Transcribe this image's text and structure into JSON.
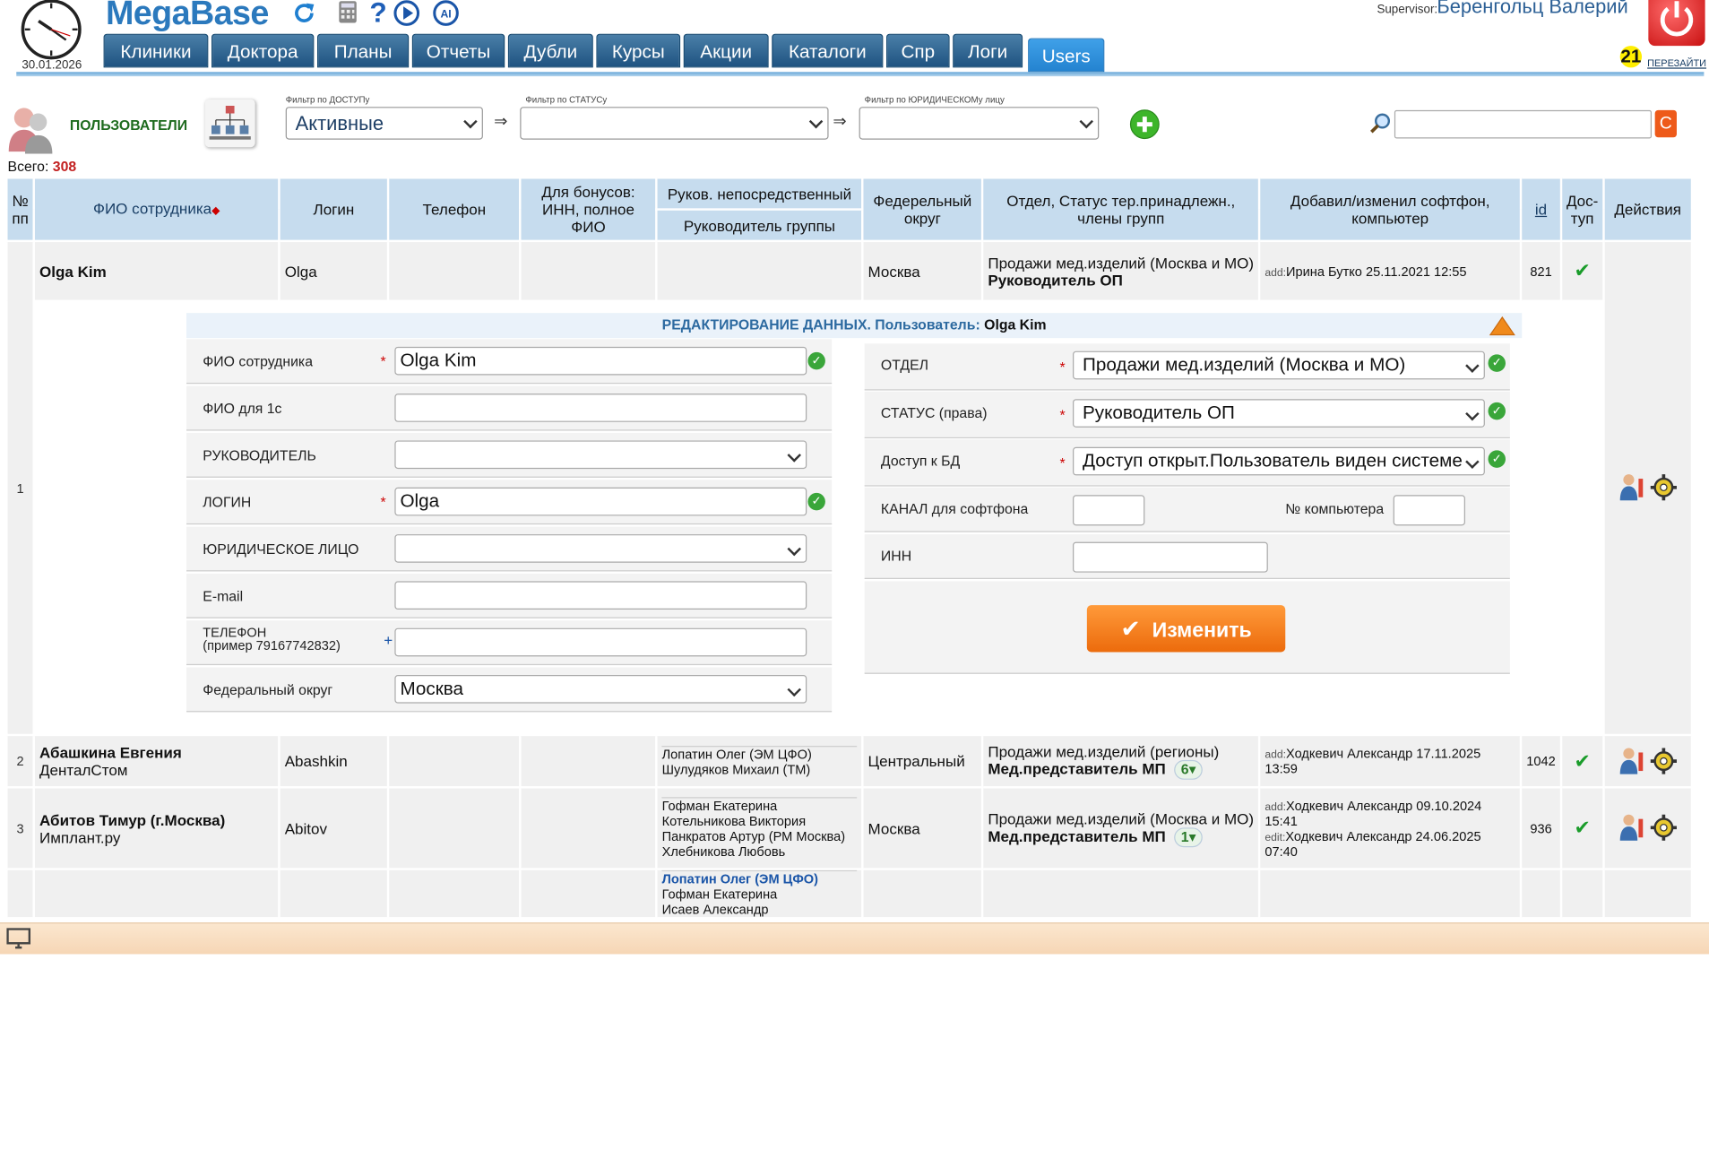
{
  "header": {
    "date": "30.01.2026",
    "logo": "MegaBase",
    "icons": [
      "refresh-icon",
      "calculator-icon",
      "help-icon",
      "play-icon",
      "ai-icon"
    ],
    "nav": [
      "Клиники",
      "Доктора",
      "Планы",
      "Отчеты",
      "Дубли",
      "Курсы",
      "Акции",
      "Каталоги",
      "Спр",
      "Логи",
      "Users"
    ],
    "active_tab": "Users",
    "supervisor_label": "Supervisor:",
    "supervisor_name": "Беренгольц Валерий",
    "badge": "21",
    "relogin": "ПЕРЕЗАЙТИ"
  },
  "filters": {
    "title": "ПОЛЬЗОВАТЕЛИ",
    "access_label": "Фильтр по ДОСТУПу",
    "access_value": "Активные",
    "status_label": "Фильтр по СТАТУСу",
    "status_value": "",
    "legal_label": "Фильтр по ЮРИДИЧЕСКОМу лицу",
    "legal_value": "",
    "arrow": "⇒",
    "search_button": "C"
  },
  "total_label": "Всего:",
  "total_value": "308",
  "columns": {
    "num": "№ пп",
    "fio": "ФИО сотрудника",
    "login": "Логин",
    "phone": "Телефон",
    "bonus": "Для бонусов: ИНН, полное ФИО",
    "head_direct": "Руков. непосредственный",
    "head_group": "Руководитель группы",
    "district": "Федерельный округ",
    "dept": "Отдел, Статус тер.принадлежн., члены групп",
    "added": "Добавил/изменил софтфон, компьютер",
    "id": "id",
    "access": "Дос-туп",
    "actions": "Действия"
  },
  "rows": [
    {
      "num": "1",
      "name": "Olga Kim",
      "sub": "",
      "login": "Olga",
      "heads": [],
      "district": "Москва",
      "dept": "Продажи мед.изделий (Москва и МО)",
      "status": "Руководитель ОП",
      "count": "",
      "added_pre": "add:",
      "added": "Ирина Бутко  25.11.2021 12:55",
      "edited_pre": "",
      "edited": "",
      "id": "821",
      "check": "✔"
    },
    {
      "num": "2",
      "name": "Абашкина Евгения",
      "sub": "ДенталСтом",
      "login": "Abashkin",
      "heads": [
        "Лопатин Олег (ЭМ ЦФО)",
        "Шулудяков Михаил (ТМ)"
      ],
      "district": "Центральный",
      "dept": "Продажи мед.изделий (регионы)",
      "status": "Мед.представитель МП",
      "count": "6",
      "added_pre": "add:",
      "added": "Ходкевич Александр  17.11.2025 13:59",
      "edited_pre": "",
      "edited": "",
      "id": "1042",
      "check": "✔"
    },
    {
      "num": "3",
      "name": "Абитов Тимур (г.Москва)",
      "sub": "Имплант.ру",
      "login": "Abitov",
      "heads": [
        "Гофман Екатерина",
        "Котельникова Виктория",
        "Панкратов Артур (РМ Москва)",
        "Хлебникова Любовь"
      ],
      "district": "Москва",
      "dept": "Продажи мед.изделий (Москва и МО)",
      "status": "Мед.представитель МП",
      "count": "1",
      "added_pre": "add:",
      "added": "Ходкевич Александр  09.10.2024 15:41",
      "edited_pre": "edit:",
      "edited": "Ходкевич Александр  24.06.2025 07:40",
      "id": "936",
      "check": "✔"
    },
    {
      "num": "",
      "name": "",
      "sub": "",
      "login": "",
      "heads": [
        "Лопатин Олег (ЭМ ЦФО)",
        "Гофман Екатерина",
        "Исаев Александр"
      ],
      "district": "",
      "dept": "",
      "status": "",
      "count": "",
      "added_pre": "",
      "added": "",
      "edited_pre": "",
      "edited": "",
      "id": "",
      "check": ""
    }
  ],
  "edit": {
    "title": "РЕДАКТИРОВАНИЕ ДАННЫХ. Пользователь:",
    "user": "Olga Kim",
    "left": [
      {
        "label": "ФИО сотрудника",
        "value": "Olga Kim",
        "required": true,
        "ok": true,
        "select": false
      },
      {
        "label": "ФИО для 1с",
        "value": "",
        "required": false,
        "ok": false,
        "select": false
      },
      {
        "label": "РУКОВОДИТЕЛЬ",
        "value": "",
        "required": false,
        "ok": false,
        "select": true
      },
      {
        "label": "ЛОГИН",
        "value": "Olga",
        "required": true,
        "ok": true,
        "select": false
      },
      {
        "label": "ЮРИДИЧЕСКОЕ ЛИЦО",
        "value": "",
        "required": false,
        "ok": false,
        "select": true
      },
      {
        "label": "E-mail",
        "value": "",
        "required": false,
        "ok": false,
        "select": false
      },
      {
        "label": "ТЕЛЕФОН",
        "label2": "(пример 79167742832)",
        "value": "",
        "required": false,
        "ok": false,
        "select": false,
        "plus": "+"
      },
      {
        "label": "Федеральный округ",
        "value": "Москва",
        "required": false,
        "ok": false,
        "select": true
      }
    ],
    "right": [
      {
        "label": "ОТДЕЛ",
        "value": "Продажи мед.изделий (Москва и МО)"
      },
      {
        "label": "СТАТУС (права)",
        "value": "Руководитель ОП"
      },
      {
        "label": "Доступ к БД",
        "value": "Доступ открыт.Пользователь виден системе"
      }
    ],
    "channel_label": "КАНАЛ для софтфона",
    "computer_label": "№ компьютера",
    "inn_label": "ИНН",
    "save": "Изменить"
  },
  "colors": {
    "accent": "#2b79bd",
    "nav": "#1f5381",
    "save": "#ec6b0c",
    "ok": "#3aa63a",
    "total": "#c21f1f"
  }
}
